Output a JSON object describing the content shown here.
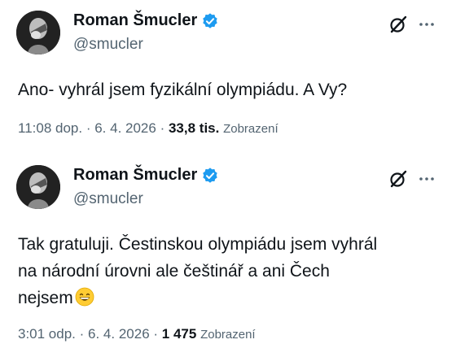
{
  "tweets": [
    {
      "author_name": "Roman Šmucler",
      "handle": "@smucler",
      "text": "Ano- vyhrál jsem fyzikální olympiádu. A Vy?",
      "time": "11:08 dop.",
      "date": "6. 4. 2026",
      "views": "33,8 tis.",
      "views_label": "Zobrazení"
    },
    {
      "author_name": "Roman Šmucler",
      "handle": "@smucler",
      "text_lines": [
        "Tak gratuluji. Čestinskou olympiádu jsem vyhrál",
        "na národní úrovni ale češtinář a ani Čech",
        "nejsem"
      ],
      "emoji": "grinning-face-with-smiling-eyes",
      "time": "3:01 odp.",
      "date": "6. 4. 2026",
      "views": "1 475",
      "views_label": "Zobrazení"
    }
  ],
  "icons": {
    "verified": "verified-badge-icon",
    "grok": "grok-icon",
    "more": "more-options-icon"
  },
  "colors": {
    "verified_blue": "#1d9bf0",
    "secondary_text": "#536471",
    "primary_text": "#0f1419"
  }
}
